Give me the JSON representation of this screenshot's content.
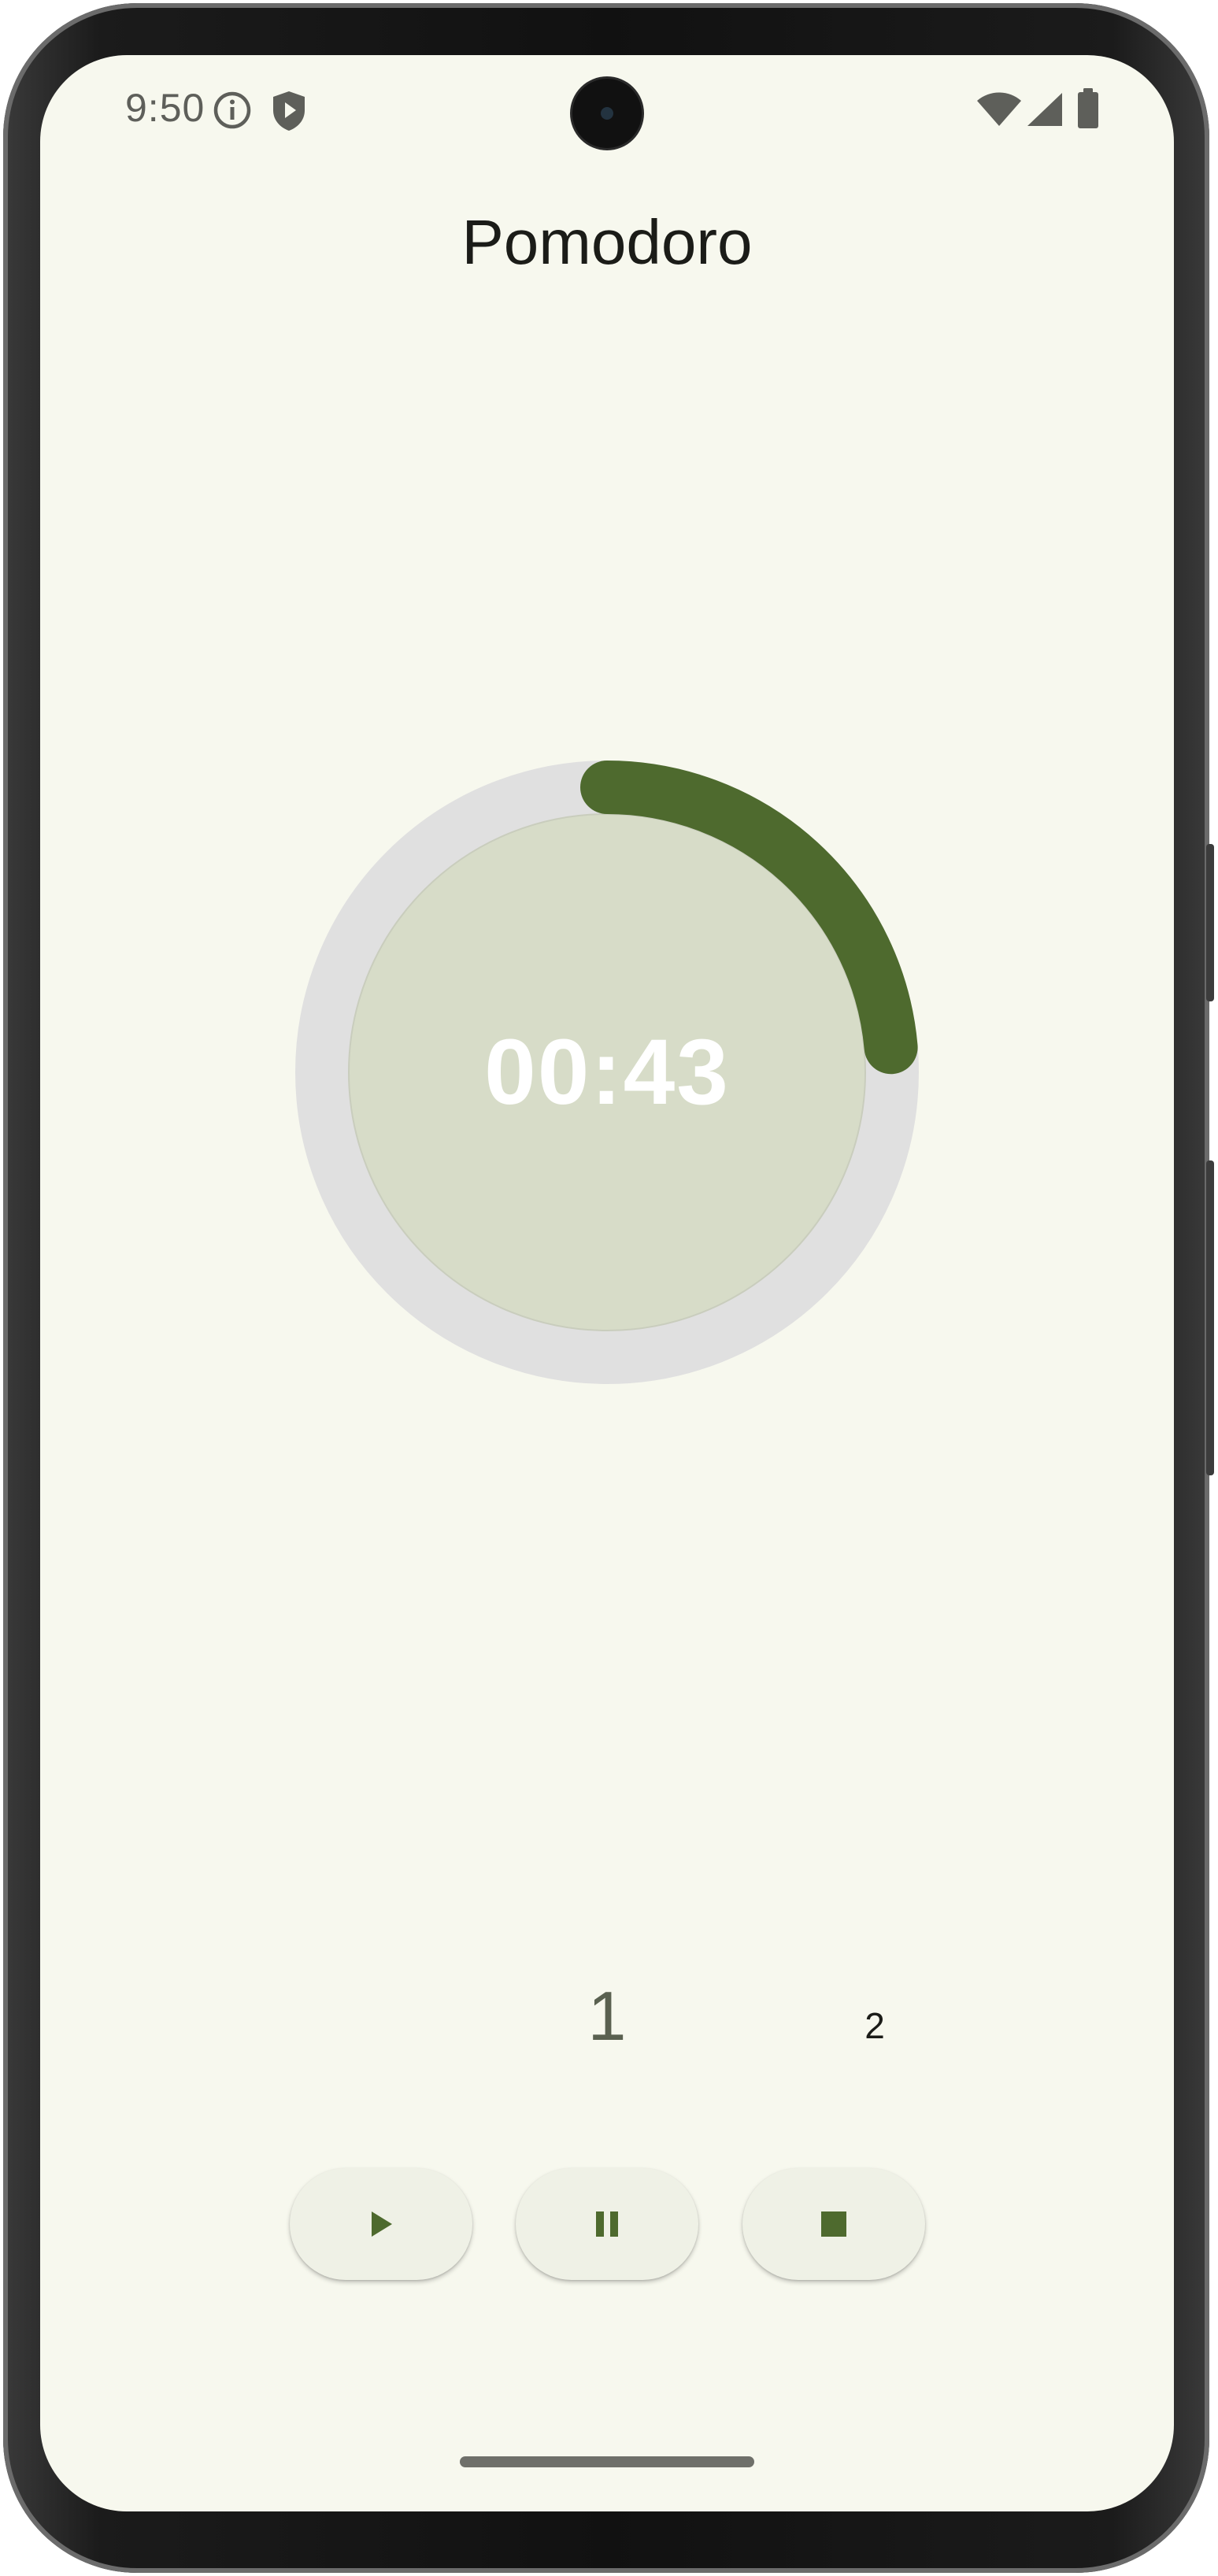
{
  "status_bar": {
    "time": "9:50",
    "icons": [
      "info-icon",
      "shield-play-icon",
      "wifi-icon",
      "signal-icon",
      "battery-icon"
    ]
  },
  "app": {
    "title": "Pomodoro"
  },
  "timer": {
    "display": "00:43",
    "progress_fraction": 0.236,
    "colors": {
      "progress": "#4E6A2E",
      "track": "#E0E0E0",
      "face": "#D7DCC8",
      "text": "#FFFFFF"
    }
  },
  "sessions": {
    "current": "1",
    "next": "2"
  },
  "controls": {
    "play_icon": "play-icon",
    "pause_icon": "pause-icon",
    "stop_icon": "stop-icon",
    "icon_color": "#4E6A2E"
  },
  "theme": {
    "background": "#F7F8EE",
    "button_background": "#EFF1E6"
  }
}
